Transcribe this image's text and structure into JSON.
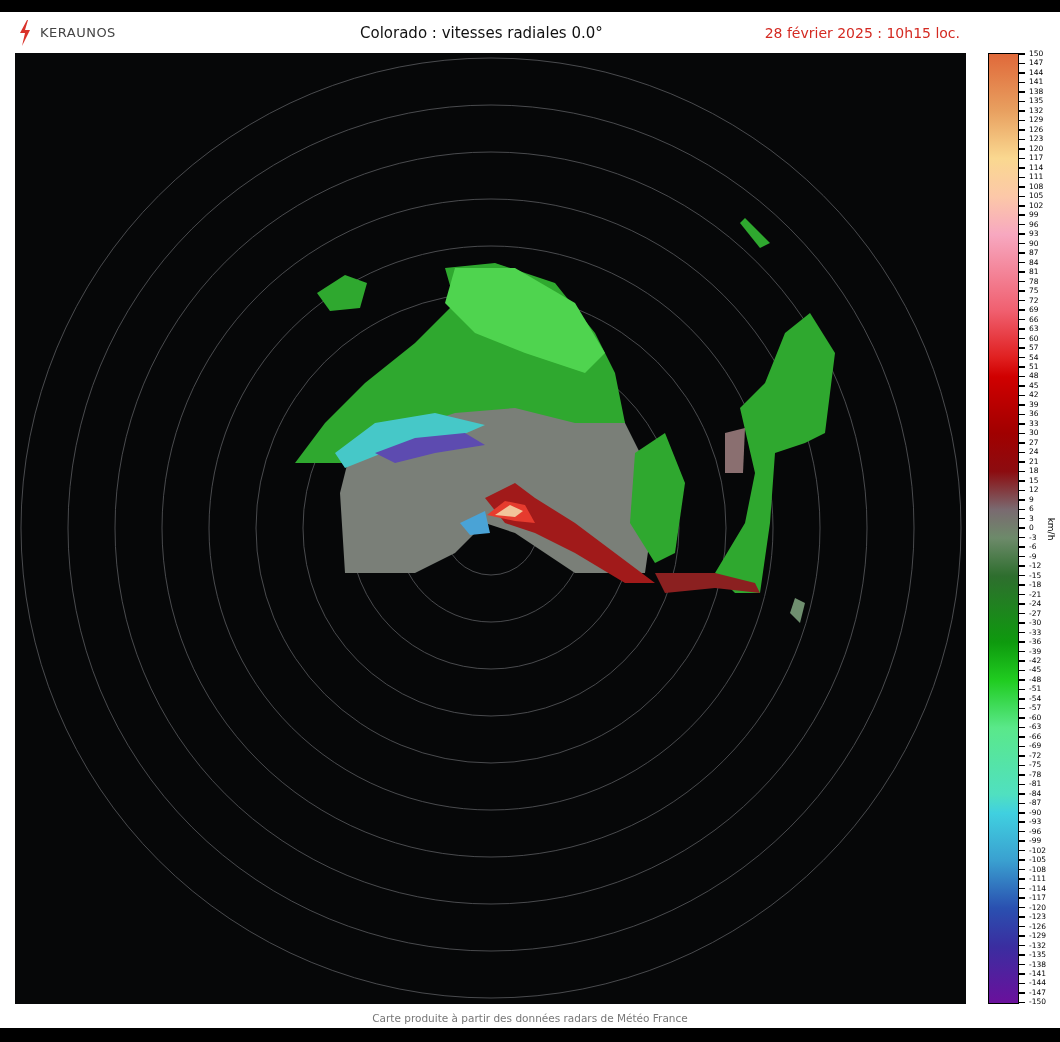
{
  "header": {
    "logo": "KERAUNOS",
    "title": "Colorado : vitesses radiales 0.0°",
    "date": "28 février 2025 : 10h15 loc."
  },
  "colorbar": {
    "unit": "km/h",
    "ticks": [
      "150",
      "147",
      "144",
      "141",
      "138",
      "135",
      "132",
      "129",
      "126",
      "123",
      "120",
      "117",
      "114",
      "111",
      "108",
      "105",
      "102",
      "99",
      "96",
      "93",
      "90",
      "87",
      "84",
      "81",
      "78",
      "75",
      "72",
      "69",
      "66",
      "63",
      "60",
      "57",
      "54",
      "51",
      "48",
      "45",
      "42",
      "39",
      "36",
      "33",
      "30",
      "27",
      "24",
      "21",
      "18",
      "15",
      "12",
      "9",
      "6",
      "3",
      "0",
      "-3",
      "-6",
      "-9",
      "-12",
      "-15",
      "-18",
      "-21",
      "-24",
      "-27",
      "-30",
      "-33",
      "-36",
      "-39",
      "-42",
      "-45",
      "-48",
      "-51",
      "-54",
      "-57",
      "-60",
      "-63",
      "-66",
      "-69",
      "-72",
      "-75",
      "-78",
      "-81",
      "-84",
      "-87",
      "-90",
      "-93",
      "-96",
      "-99",
      "-102",
      "-105",
      "-108",
      "-111",
      "-114",
      "-117",
      "-120",
      "-123",
      "-126",
      "-129",
      "-132",
      "-135",
      "-138",
      "-141",
      "-144",
      "-147",
      "-150"
    ]
  },
  "footer": "Carte produite à partir des données radars de Météo France"
}
